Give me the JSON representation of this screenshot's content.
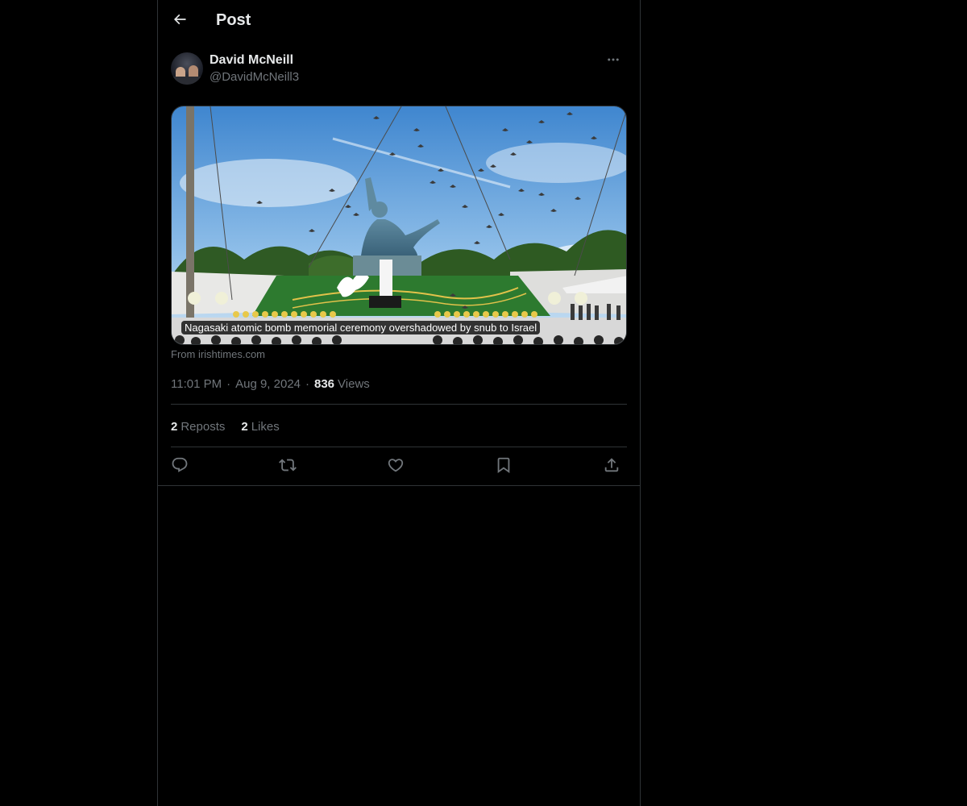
{
  "header": {
    "title": "Post",
    "back_icon": "arrow-left-icon"
  },
  "author": {
    "name": "David McNeill",
    "handle": "@DavidMcNeill3",
    "more_icon": "more-horizontal-icon"
  },
  "link_card": {
    "caption": "Nagasaki atomic bomb memorial ceremony overshadowed by snub to Israel",
    "source": "From irishtimes.com"
  },
  "meta": {
    "time": "11:01 PM",
    "date": "Aug 9, 2024",
    "views_count": "836",
    "views_label": "Views",
    "separator": "·"
  },
  "stats": {
    "reposts_count": "2",
    "reposts_label": "Reposts",
    "likes_count": "2",
    "likes_label": "Likes"
  },
  "actions": [
    {
      "name": "reply",
      "icon": "reply-icon"
    },
    {
      "name": "repost",
      "icon": "repost-icon"
    },
    {
      "name": "like",
      "icon": "heart-icon"
    },
    {
      "name": "bookmark",
      "icon": "bookmark-icon"
    },
    {
      "name": "share",
      "icon": "share-icon"
    }
  ],
  "colors": {
    "background": "#000000",
    "text_primary": "#e7e9ea",
    "text_secondary": "#71767b",
    "border": "#2f3336"
  }
}
